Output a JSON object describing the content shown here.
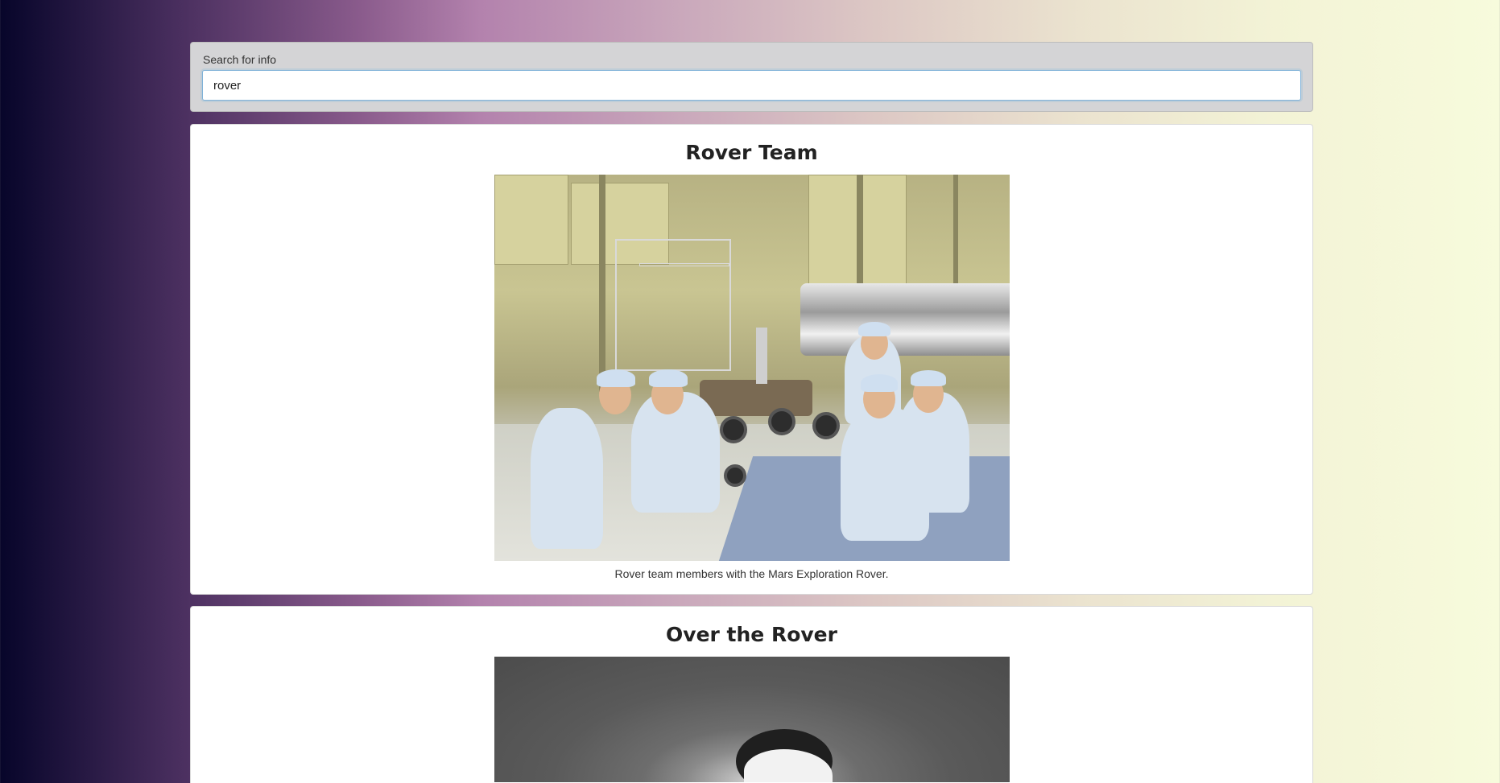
{
  "search": {
    "label": "Search for info",
    "value": "rover"
  },
  "results": [
    {
      "title": "Rover Team",
      "image_alt": "Rover team members posing in lab with rover",
      "caption": "Rover team members with the Mars Exploration Rover."
    },
    {
      "title": "Over the Rover",
      "image_alt": "Grayscale overhead view of rover"
    }
  ],
  "icons": {
    "photo_1": "photo-rover-team",
    "photo_2": "photo-over-rover"
  }
}
